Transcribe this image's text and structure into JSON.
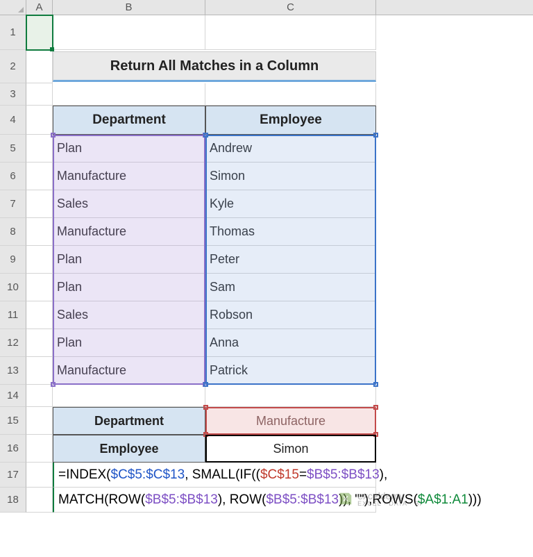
{
  "columns": {
    "A": "A",
    "B": "B",
    "C": "C"
  },
  "rows": {
    "r1": "1",
    "r2": "2",
    "r3": "3",
    "r4": "4",
    "r5": "5",
    "r6": "6",
    "r7": "7",
    "r8": "8",
    "r9": "9",
    "r10": "10",
    "r11": "11",
    "r12": "12",
    "r13": "13",
    "r14": "14",
    "r15": "15",
    "r16": "16",
    "r17": "17",
    "r18": "18"
  },
  "title": "Return All Matches in a Column",
  "headers": {
    "dep": "Department",
    "emp": "Employee"
  },
  "table": [
    {
      "dep": "Plan",
      "emp": "Andrew"
    },
    {
      "dep": "Manufacture",
      "emp": "Simon"
    },
    {
      "dep": "Sales",
      "emp": "Kyle"
    },
    {
      "dep": "Manufacture",
      "emp": "Thomas"
    },
    {
      "dep": "Plan",
      "emp": "Peter"
    },
    {
      "dep": "Plan",
      "emp": "Sam"
    },
    {
      "dep": "Sales",
      "emp": "Robson"
    },
    {
      "dep": "Plan",
      "emp": "Anna"
    },
    {
      "dep": "Manufacture",
      "emp": "Patrick"
    }
  ],
  "filter": {
    "dep_label": "Department",
    "dep_value": "Manufacture",
    "emp_label": "Employee",
    "emp_value": "Simon"
  },
  "formula": {
    "t0": "=INDEX(",
    "range1": "$C$5:$C$13",
    "t1": ", SMALL(IF((",
    "crit": "$C$15",
    "t2": "=",
    "range2": "$B$5:$B$13",
    "t3": "),",
    "line2a": "MATCH(ROW(",
    "range3": "$B$5:$B$13",
    "t4": "), ROW(",
    "range4": "$B$5:$B$13",
    "t5": ")), \"\"),ROWS(",
    "rowsref": "$A$1:A1",
    "t6": ")))"
  },
  "watermark": {
    "brand": "exceldemy",
    "tag": "EXCEL · DATA · BI"
  }
}
